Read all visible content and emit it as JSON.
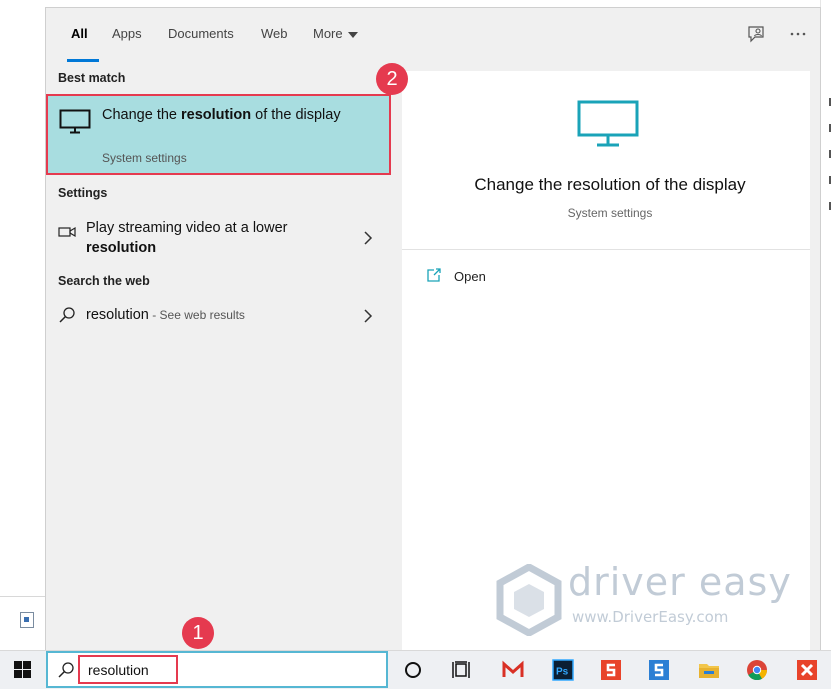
{
  "tabs": [
    {
      "label": "All"
    },
    {
      "label": "Apps"
    },
    {
      "label": "Documents"
    },
    {
      "label": "Web"
    },
    {
      "label": "More"
    }
  ],
  "sections": {
    "best_match": "Best match",
    "settings": "Settings",
    "search_web": "Search the web"
  },
  "best_match": {
    "title_pre": "Change the ",
    "title_bold": "resolution",
    "title_post": " of the display",
    "subtitle": "System settings"
  },
  "settings_result": {
    "text": "Play streaming video at a lower ",
    "bold": "resolution"
  },
  "web_result": {
    "query": "resolution",
    "suffix": " - See web results"
  },
  "preview": {
    "title": "Change the resolution of the display",
    "subtitle": "System settings",
    "open_label": "Open"
  },
  "search": {
    "value": "resolution"
  },
  "badges": {
    "one": "1",
    "two": "2"
  },
  "watermark": {
    "brand": "driver easy",
    "url": "www.DriverEasy.com"
  },
  "taskbar_icons": [
    "cortana-circle-icon",
    "task-view-icon",
    "gmail-icon",
    "photoshop-icon",
    "app-s-red-icon",
    "app-s-blue-icon",
    "file-explorer-icon",
    "chrome-icon",
    "xmind-icon"
  ],
  "colors": {
    "accent": "#0078d7",
    "highlight": "#a8dde0",
    "callout": "#e53a4f",
    "search_border": "#56b7d3"
  }
}
